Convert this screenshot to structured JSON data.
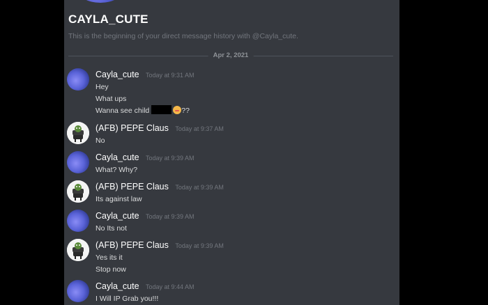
{
  "channel": {
    "title": "CAYLA_CUTE",
    "intro": "This is the beginning of your direct message history with @Cayla_cute."
  },
  "divider": {
    "date": "Apr 2, 2021"
  },
  "messages": [
    {
      "author": "Cayla_cute",
      "avatar": "cayla",
      "time": "Today at 9:31 AM",
      "lines": [
        "Hey",
        "What ups",
        "Wanna see child"
      ],
      "redacted_suffix": "??"
    },
    {
      "author": "(AFB) PEPE Claus",
      "avatar": "pepe",
      "time": "Today at 9:37 AM",
      "lines": [
        "No"
      ]
    },
    {
      "author": "Cayla_cute",
      "avatar": "cayla",
      "time": "Today at 9:39 AM",
      "lines": [
        "What? Why?"
      ]
    },
    {
      "author": "(AFB) PEPE Claus",
      "avatar": "pepe",
      "time": "Today at 9:39 AM",
      "lines": [
        "Its against law"
      ]
    },
    {
      "author": "Cayla_cute",
      "avatar": "cayla",
      "time": "Today at 9:39 AM",
      "lines": [
        "No Its not"
      ]
    },
    {
      "author": "(AFB) PEPE Claus",
      "avatar": "pepe",
      "time": "Today at 9:39 AM",
      "lines": [
        "Yes its it",
        "Stop now"
      ]
    },
    {
      "author": "Cayla_cute",
      "avatar": "cayla",
      "time": "Today at 9:44 AM",
      "lines": [
        "I Will IP Grab you!!!"
      ]
    }
  ],
  "colors": {
    "background": "#000000",
    "chat_bg": "#36393f",
    "author": "#ffffff",
    "message_text": "#dcddde",
    "muted": "#72767d"
  },
  "icons": {
    "cayla_avatar": "blue-gradient-avatar-icon",
    "pepe_avatar": "pepe-chair-avatar-icon",
    "emoji": "face-emoji-icon"
  }
}
